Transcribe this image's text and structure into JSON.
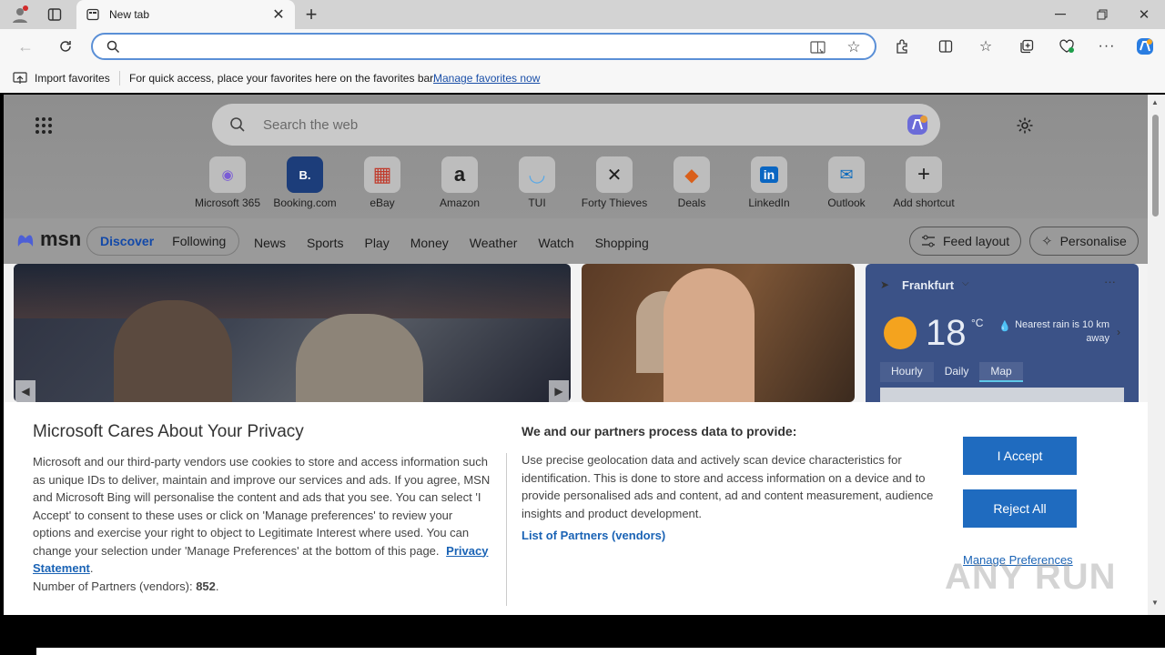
{
  "browser": {
    "tab_title": "New tab",
    "import_favorites": "Import favorites",
    "favbar_message": "For quick access, place your favorites here on the favorites bar.",
    "manage_favorites": "Manage favorites now"
  },
  "search": {
    "placeholder": "Search the web"
  },
  "quick_links": [
    {
      "label": "Microsoft 365",
      "glyph": "◉",
      "color": "#7b5cd6"
    },
    {
      "label": "Booking.com",
      "glyph": "B.",
      "color": "#1c3d7a"
    },
    {
      "label": "eBay",
      "glyph": "▦",
      "color": "#c03a2b"
    },
    {
      "label": "Amazon",
      "glyph": "a",
      "color": "#111111"
    },
    {
      "label": "TUI",
      "glyph": "◡",
      "color": "#5aa9e6"
    },
    {
      "label": "Forty Thieves",
      "glyph": "✕",
      "color": "#222222"
    },
    {
      "label": "Deals",
      "glyph": "◆",
      "color": "#d95f1a"
    },
    {
      "label": "LinkedIn",
      "glyph": "in",
      "color": "#0a66c2"
    },
    {
      "label": "Outlook",
      "glyph": "✉",
      "color": "#0f6cbd"
    },
    {
      "label": "Add shortcut",
      "glyph": "+",
      "color": "#333333"
    }
  ],
  "feed": {
    "logo": "msn",
    "tabs": [
      "Discover",
      "Following"
    ],
    "nav": [
      "News",
      "Sports",
      "Play",
      "Money",
      "Weather",
      "Watch",
      "Shopping"
    ],
    "feed_layout": "Feed layout",
    "personalise": "Personalise"
  },
  "weather": {
    "city": "Frankfurt",
    "temp": "18",
    "unit": "°C",
    "note": "Nearest rain is 10 km away",
    "tabs": [
      "Hourly",
      "Daily",
      "Map"
    ]
  },
  "privacy": {
    "title": "Microsoft Cares About Your Privacy",
    "body": "Microsoft and our third-party vendors use cookies to store and access information such as unique IDs to deliver, maintain and improve our services and ads. If you agree, MSN and Microsoft Bing will personalise the content and ads that you see. You can select 'I Accept' to consent to these uses or click on 'Manage preferences' to review your options and exercise your right to object to Legitimate Interest where used.  You can change your selection under 'Manage Preferences' at the bottom of this page.",
    "privacy_link": "Privacy Statement",
    "partners_label": "Number of Partners (vendors):",
    "partners_count": "852",
    "right_title": "We and our partners process data to provide:",
    "right_body": "Use precise geolocation data and actively scan device characteristics for identification. This is done to store and access information on a device and to provide personalised ads and content, ad and content measurement, audience insights and product development.",
    "partners_link": "List of Partners (vendors)",
    "accept": "I Accept",
    "reject": "Reject All",
    "manage": "Manage Preferences"
  },
  "watermark": "ANY RUN"
}
